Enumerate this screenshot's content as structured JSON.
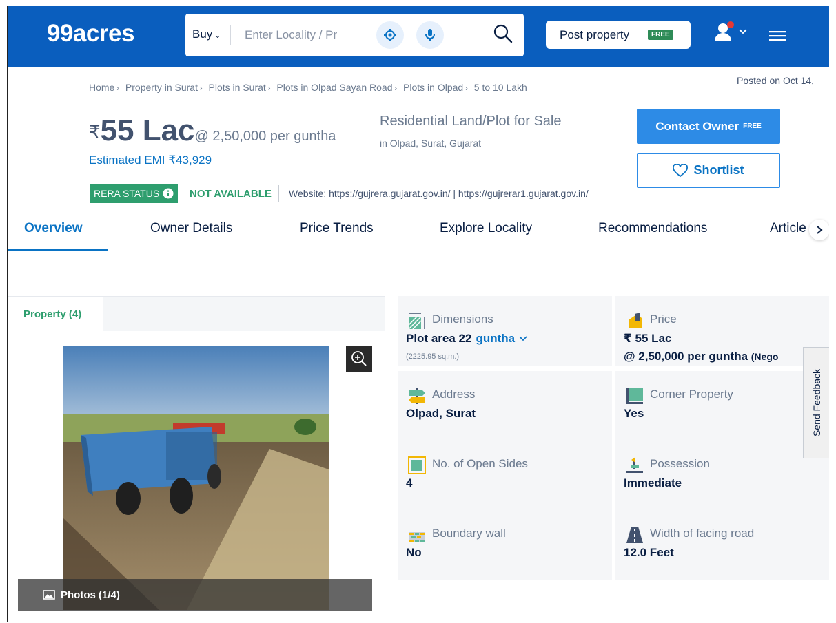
{
  "header": {
    "logo": "99acres",
    "search": {
      "mode": "Buy",
      "placeholder": "Enter Locality / Pr"
    },
    "post_property": "Post property",
    "post_free_tag": "FREE"
  },
  "breadcrumb": [
    "Home",
    "Property in Surat",
    "Plots in Surat",
    "Plots in Olpad Sayan Road",
    "Plots in Olpad",
    "5 to 10 Lakh"
  ],
  "posted_on": "Posted on Oct 14,",
  "listing": {
    "currency": "₹",
    "price": "55 Lac",
    "price_per": "@ 2,50,000 per guntha",
    "emi": "Estimated EMI ₹43,929",
    "type": "Residential Land/Plot for Sale",
    "location": "in Olpad, Surat, Gujarat",
    "contact_label": "Contact Owner",
    "contact_free": "FREE",
    "shortlist_label": "Shortlist"
  },
  "rera": {
    "label": "RERA STATUS",
    "value": "NOT AVAILABLE",
    "website": "Website: https://gujrera.gujarat.gov.in/ | https://gujrerar1.gujarat.gov.in/"
  },
  "tabs": [
    "Overview",
    "Owner Details",
    "Price Trends",
    "Explore Locality",
    "Recommendations",
    "Article"
  ],
  "gallery": {
    "tab": "Property (4)",
    "photos_label": "Photos (1/4)"
  },
  "details": {
    "dimensions": {
      "title": "Dimensions",
      "value": "Plot area 22",
      "unit": "guntha",
      "sub": "(2225.95 sq.m.)"
    },
    "price": {
      "title": "Price",
      "value": "₹ 55 Lac",
      "value2": "@ 2,50,000 per guntha",
      "suffix": "(Nego"
    },
    "address": {
      "title": "Address",
      "value": "Olpad, Surat"
    },
    "corner": {
      "title": "Corner Property",
      "value": "Yes"
    },
    "open_sides": {
      "title": "No. of Open Sides",
      "value": "4"
    },
    "possession": {
      "title": "Possession",
      "value": "Immediate"
    },
    "boundary": {
      "title": "Boundary wall",
      "value": "No"
    },
    "road": {
      "title": "Width of facing road",
      "value": "12.0 Feet"
    }
  },
  "feedback": "Send Feedback",
  "colors": {
    "header_bg": "#0a5ebe",
    "accent_blue": "#0a73c4",
    "rera_green": "#2e9e6e"
  }
}
